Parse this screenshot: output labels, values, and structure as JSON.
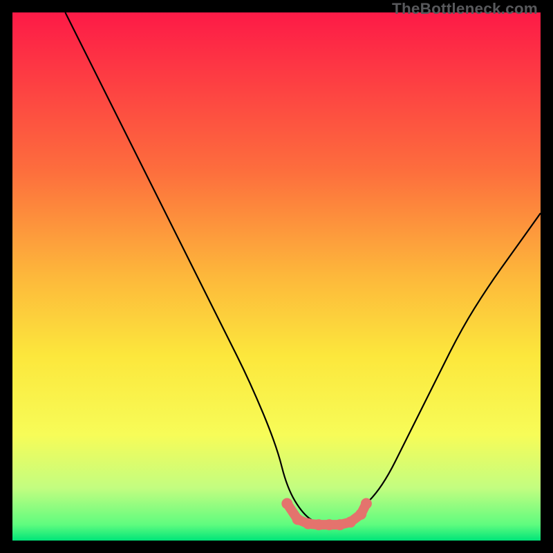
{
  "watermark": "TheBottleneck.com",
  "colors": {
    "top": "#fd1a47",
    "mid_upper": "#fd8f3b",
    "mid": "#fce73c",
    "mid_lower": "#f7fc58",
    "near_bottom": "#c3fd80",
    "bottom": "#00e579",
    "curve": "#000000",
    "marker": "#e4736d"
  },
  "chart_data": {
    "type": "line",
    "title": "",
    "xlabel": "",
    "ylabel": "",
    "xlim": [
      0,
      100
    ],
    "ylim": [
      0,
      100
    ],
    "series": [
      {
        "name": "bottleneck-curve",
        "x": [
          10,
          15,
          20,
          25,
          30,
          35,
          40,
          45,
          50,
          52,
          55,
          58,
          60,
          63,
          65,
          70,
          75,
          80,
          85,
          90,
          95,
          100
        ],
        "y": [
          100,
          90,
          80,
          70,
          60,
          50,
          40,
          30,
          18,
          10,
          5,
          3,
          3,
          3,
          5,
          10,
          20,
          30,
          40,
          48,
          55,
          62
        ]
      }
    ],
    "markers": {
      "name": "optimal-range",
      "x": [
        52,
        54,
        56,
        58,
        60,
        62,
        64,
        66,
        67
      ],
      "y": [
        7,
        4,
        3.2,
        3,
        3,
        3,
        3.5,
        5,
        7
      ]
    },
    "gradient_bands": [
      {
        "y": 100,
        "color": "#fd1a47"
      },
      {
        "y": 70,
        "color": "#fd6e3d"
      },
      {
        "y": 50,
        "color": "#fdb83b"
      },
      {
        "y": 35,
        "color": "#fce73c"
      },
      {
        "y": 20,
        "color": "#f7fc58"
      },
      {
        "y": 10,
        "color": "#c3fd80"
      },
      {
        "y": 3,
        "color": "#5ffc7f"
      },
      {
        "y": 0,
        "color": "#00e579"
      }
    ]
  }
}
